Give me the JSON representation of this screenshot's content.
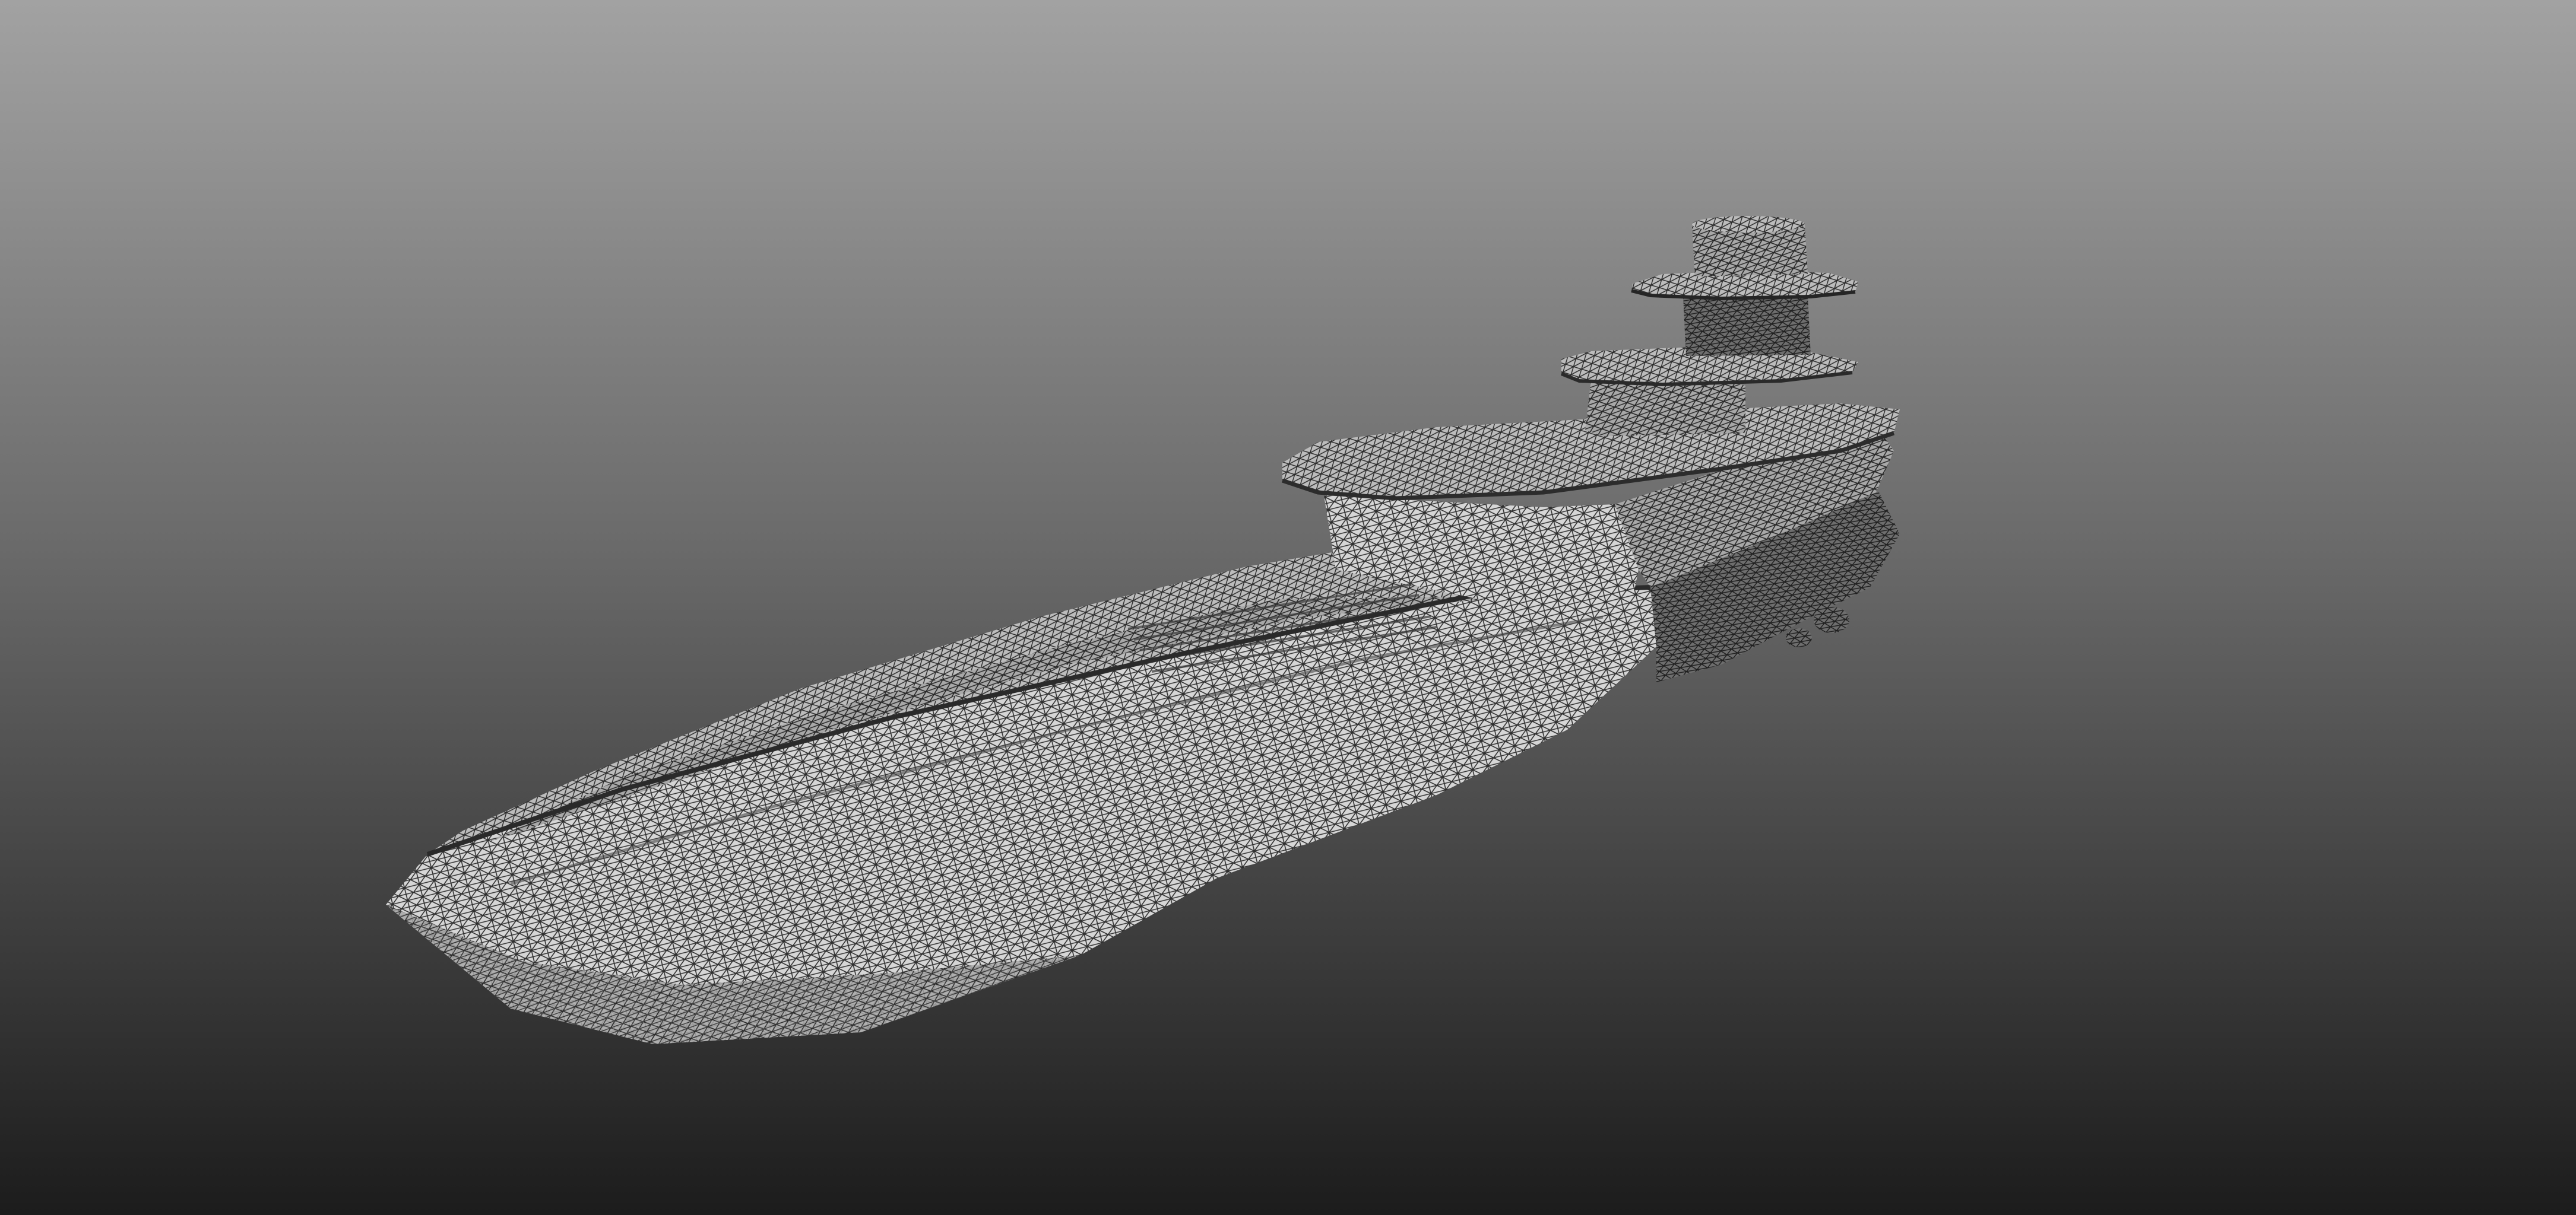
{
  "viewport": {
    "background_top": "#a2a2a2",
    "background_mid": "#6a6a6a",
    "background_bottom": "#1c1c1c",
    "render_mode": "wireframe",
    "mesh_fill": "#d2d2d2",
    "mesh_shadow": "#6c6c6c",
    "mesh_line": "#2e2e2e"
  },
  "model": {
    "kind": "ship-hull-mesh",
    "parts": [
      "hull",
      "deck",
      "superstructure",
      "bridge-deck",
      "upper-deck",
      "mast-disc",
      "mast-top"
    ]
  }
}
